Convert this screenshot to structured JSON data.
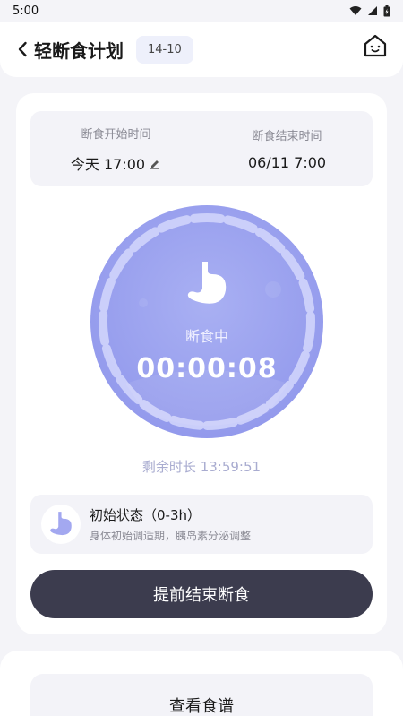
{
  "status_bar": {
    "time": "5:00"
  },
  "header": {
    "title": "轻断食计划",
    "badge": "14-10"
  },
  "schedule": {
    "start_label": "断食开始时间",
    "start_value": "今天 17:00",
    "end_label": "断食结束时间",
    "end_value": "06/11 7:00"
  },
  "timer": {
    "status": "断食中",
    "elapsed": "00:00:08",
    "remaining": "剩余时长 13:59:51"
  },
  "stage": {
    "title": "初始状态（0-3h）",
    "description": "身体初始调适期，胰岛素分泌调整"
  },
  "actions": {
    "end_early": "提前结束断食",
    "view_recipes": "查看食谱"
  },
  "colors": {
    "circle": "#9ea6ef",
    "ring": "#d3d7fb",
    "button_dark": "#3c3c4e",
    "accent": "#a9acd0"
  }
}
